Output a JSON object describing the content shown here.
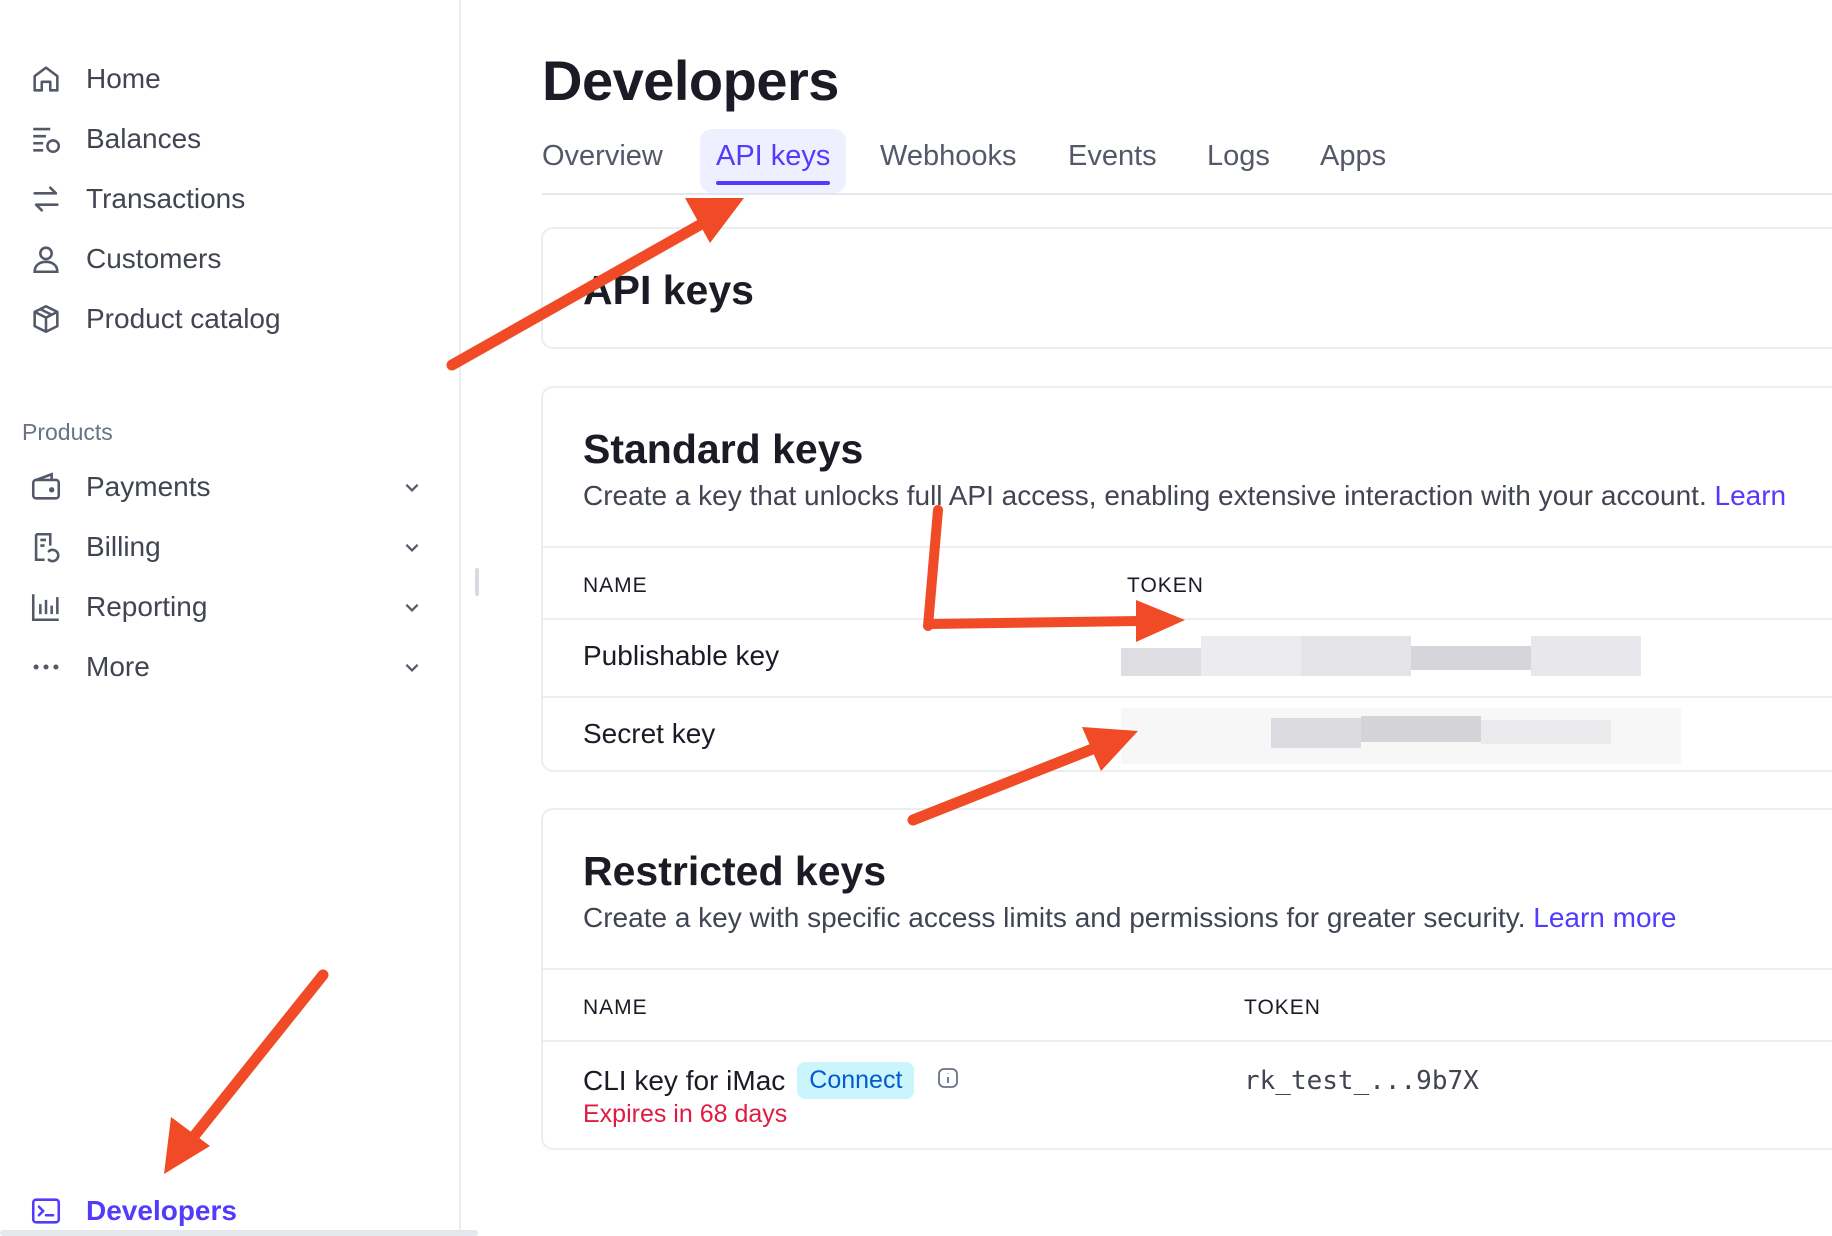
{
  "sidebar": {
    "items": [
      {
        "label": "Home",
        "icon": "home-icon"
      },
      {
        "label": "Balances",
        "icon": "balances-icon"
      },
      {
        "label": "Transactions",
        "icon": "transactions-icon"
      },
      {
        "label": "Customers",
        "icon": "customer-icon"
      },
      {
        "label": "Product catalog",
        "icon": "box-icon"
      }
    ],
    "section_label": "Products",
    "products": [
      {
        "label": "Payments",
        "icon": "wallet-icon"
      },
      {
        "label": "Billing",
        "icon": "billing-icon"
      },
      {
        "label": "Reporting",
        "icon": "bar-chart-icon"
      },
      {
        "label": "More",
        "icon": "more-dots-icon"
      }
    ],
    "bottom_item": {
      "label": "Developers",
      "icon": "terminal-icon"
    }
  },
  "page": {
    "title": "Developers",
    "tabs": [
      "Overview",
      "API keys",
      "Webhooks",
      "Events",
      "Logs",
      "Apps"
    ],
    "active_tab": "API keys"
  },
  "api_keys_card": {
    "title": "API keys"
  },
  "standard_keys": {
    "title": "Standard keys",
    "description": "Create a key that unlocks full API access, enabling extensive interaction with your account.",
    "link_text": "Learn",
    "col_name": "NAME",
    "col_token": "TOKEN",
    "rows": [
      {
        "name": "Publishable key"
      },
      {
        "name": "Secret key"
      }
    ]
  },
  "restricted_keys": {
    "title": "Restricted keys",
    "description": "Create a key with specific access limits and permissions for greater security.",
    "link_text": "Learn more",
    "col_name": "NAME",
    "col_token": "TOKEN",
    "rows": [
      {
        "name": "CLI key for iMac",
        "badge": "Connect",
        "expires": "Expires in 68 days",
        "token": "rk_test_...9b7X"
      }
    ]
  },
  "colors": {
    "accent": "#533afd",
    "annotation_arrow": "#f04a26",
    "expire": "#df1b41"
  }
}
